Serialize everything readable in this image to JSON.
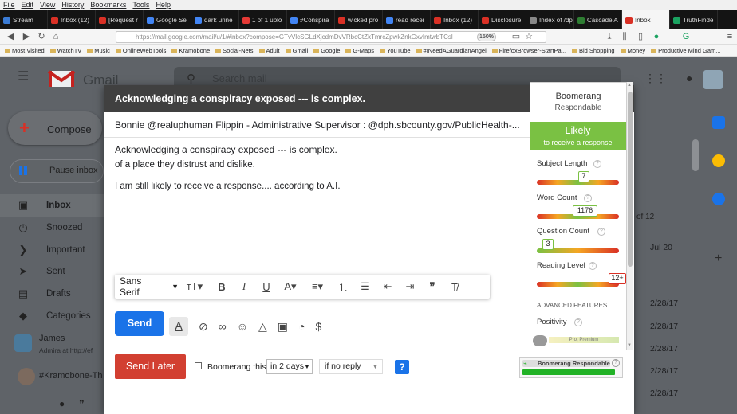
{
  "browser": {
    "menu": [
      "File",
      "Edit",
      "View",
      "History",
      "Bookmarks",
      "Tools",
      "Help"
    ],
    "tabs": [
      {
        "label": "Stream",
        "color": "#3a7bd5"
      },
      {
        "label": "Inbox (12)",
        "color": "#d93025"
      },
      {
        "label": "[Request r",
        "color": "#d93025"
      },
      {
        "label": "Google Se",
        "color": "#4285f4"
      },
      {
        "label": "dark urine",
        "color": "#4285f4"
      },
      {
        "label": "1 of 1 uplo",
        "color": "#e53935"
      },
      {
        "label": "#Conspira",
        "color": "#4285f4"
      },
      {
        "label": "wicked pro",
        "color": "#d93025"
      },
      {
        "label": "read recei",
        "color": "#4285f4"
      },
      {
        "label": "Inbox (12)",
        "color": "#d93025"
      },
      {
        "label": "Disclosure",
        "color": "#d93025"
      },
      {
        "label": "Index of /dph",
        "color": "#888888"
      },
      {
        "label": "Cascade A",
        "color": "#2e7d32"
      },
      {
        "label": "Inbox",
        "color": "#d93025",
        "active": true
      },
      {
        "label": "TruthFinde",
        "color": "#1aa260"
      }
    ],
    "url": "https://mail.google.com/mail/u/1/#inbox?compose=GTvVlcSGLdXjcdmDvVRbcCtZkTmrcZpwkZnkGxvImtwbTCsl",
    "zoom": "150%",
    "bookmarks": [
      "Most Visited",
      "WatchTV",
      "Music",
      "OnlineWebTools",
      "Kramobone",
      "Social-Nets",
      "Adult",
      "Gmail",
      "Google",
      "G-Maps",
      "YouTube",
      "#INeedAGuardianAngel",
      "FirefoxBrowser-StartPa...",
      "Bid Shopping",
      "Money",
      "Productive Mind Gam..."
    ]
  },
  "gmail": {
    "logo_text": "Gmail",
    "search_placeholder": "Search mail",
    "compose_label": "Compose",
    "pause_label": "Pause inbox",
    "sidebar": [
      {
        "label": "Inbox",
        "icon": "inbox-icon",
        "glyph": "▣"
      },
      {
        "label": "Snoozed",
        "icon": "clock-icon",
        "glyph": "◷"
      },
      {
        "label": "Important",
        "icon": "important-icon",
        "glyph": "❯"
      },
      {
        "label": "Sent",
        "icon": "send-icon",
        "glyph": "➤"
      },
      {
        "label": "Drafts",
        "icon": "draft-icon",
        "glyph": "▤"
      },
      {
        "label": "Categories",
        "icon": "label-icon",
        "glyph": "◆"
      }
    ],
    "hangouts": [
      {
        "name": "James",
        "sub": "Admira at http://ef"
      },
      {
        "name": "#Kramobone-Th"
      }
    ],
    "pagination": "of 12",
    "dates": [
      "Jul 20",
      "2/28/17",
      "2/28/17",
      "2/28/17",
      "2/28/17",
      "2/28/17"
    ]
  },
  "compose": {
    "title": "Acknowledging a conspiracy exposed --- is complex.",
    "to": "Bonnie @realuphuman Flippin - Administrative Supervisor : @dph.sbcounty.gov/PublicHealth-...",
    "subject": "Acknowledging a conspiracy exposed --- is complex.",
    "body_cut": "of a place they distrust and dislike.",
    "body": "I am still likely to receive a response.... according to A.I.",
    "font": "Sans Serif",
    "send": "Send",
    "send_later": "Send Later",
    "boomerang_this": "Boomerang this",
    "days_option": "in 2 days",
    "reply_option": "if no reply",
    "help": "?",
    "bar_label": "Boomerang Respondable"
  },
  "boomerang": {
    "title": "Boomerang",
    "subtitle": "Respondable",
    "verdict": "Likely",
    "verdict_sub": "to receive a response",
    "metrics": [
      {
        "label": "Subject Length",
        "value": "7"
      },
      {
        "label": "Word Count",
        "value": "1176"
      },
      {
        "label": "Question Count",
        "value": "3"
      },
      {
        "label": "Reading Level",
        "value": "12+"
      }
    ],
    "advanced": "ADVANCED FEATURES",
    "positivity": "Positivity",
    "pro": "Pro, Premium"
  }
}
